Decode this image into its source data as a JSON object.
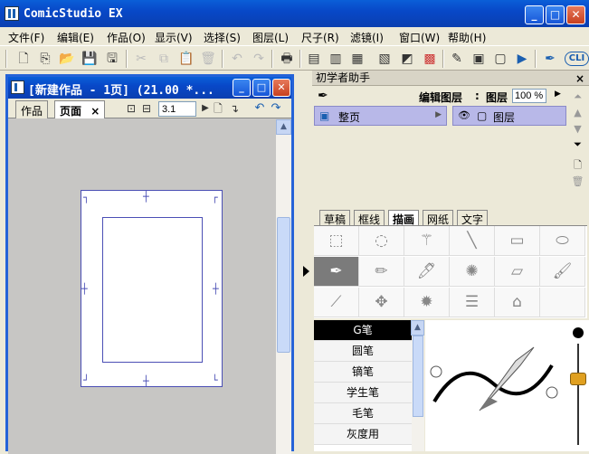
{
  "app": {
    "title": "ComicStudio EX",
    "window_controls": [
      "_",
      "□",
      "✕"
    ]
  },
  "menu": [
    "文件(F)",
    "编辑(E)",
    "作品(O)",
    "显示(V)",
    "选择(S)",
    "图层(L)",
    "尺子(R)",
    "滤镜(I)",
    "窗口(W)",
    "帮助(H)"
  ],
  "toolbar": {
    "icons": [
      "new-icon",
      "new-page-icon",
      "open-icon",
      "save-icon",
      "save-all-icon",
      "cut-icon",
      "copy-icon",
      "paste-icon",
      "delete-icon",
      "undo-icon",
      "redo-icon",
      "print-icon",
      "page-manager-icon",
      "layer-property-icon",
      "navigator-icon",
      "tool-option-icon",
      "color-icon",
      "zoom-in-icon",
      "window-icon",
      "export-icon",
      "help-icon",
      "clip-icon"
    ],
    "clip_label": "CLI"
  },
  "document": {
    "title": "[新建作品 - 1页] (21.00 *...",
    "tabs": [
      "作品",
      "页面"
    ],
    "active_tab": "页面",
    "tab_close": "×",
    "page_number": "3.1"
  },
  "panel": {
    "title": "初学者助手",
    "close": "×",
    "edit_layer_label": "编辑图层",
    "colon": ":",
    "layer_label": "图层",
    "opacity_value": "100 %",
    "left_item": "整页",
    "right_item": "图层",
    "tool_tabs": [
      "草稿",
      "框线",
      "描画",
      "网纸",
      "文字"
    ],
    "active_tool_tab": "描画",
    "tool_icons": [
      [
        "select-rect-icon",
        "lasso-icon",
        "magic-wand-icon",
        "line-icon",
        "rectangle-icon",
        "ellipse-icon"
      ],
      [
        "pen-icon",
        "pencil-icon",
        "marker-icon",
        "airbrush-icon",
        "eraser-icon",
        "brush-icon"
      ],
      [
        "eyedropper-icon",
        "move-icon",
        "radial-line-icon",
        "parallel-line-icon",
        "pattern-icon",
        ""
      ]
    ],
    "pens": [
      "G笔",
      "圆笔",
      "镝笔",
      "学生笔",
      "毛笔",
      "灰度用"
    ],
    "selected_pen": "G笔"
  }
}
